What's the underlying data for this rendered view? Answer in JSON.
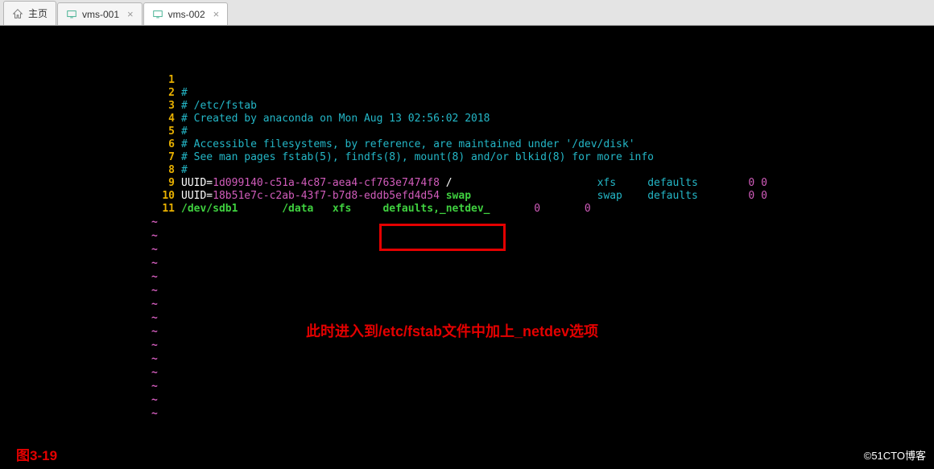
{
  "tabs": [
    {
      "label": "主页",
      "closable": false
    },
    {
      "label": "vms-001",
      "closable": true
    },
    {
      "label": "vms-002",
      "closable": true,
      "active": true
    }
  ],
  "editor": {
    "lines": [
      {
        "n": "1",
        "parts": []
      },
      {
        "n": "2",
        "parts": [
          {
            "cls": "comment",
            "t": "#"
          }
        ]
      },
      {
        "n": "3",
        "parts": [
          {
            "cls": "comment",
            "t": "# /etc/fstab"
          }
        ]
      },
      {
        "n": "4",
        "parts": [
          {
            "cls": "comment",
            "t": "# Created by anaconda on Mon Aug 13 02:56:02 2018"
          }
        ]
      },
      {
        "n": "5",
        "parts": [
          {
            "cls": "comment",
            "t": "#"
          }
        ]
      },
      {
        "n": "6",
        "parts": [
          {
            "cls": "comment",
            "t": "# Accessible filesystems, by reference, are maintained under '/dev/disk'"
          }
        ]
      },
      {
        "n": "7",
        "parts": [
          {
            "cls": "comment",
            "t": "# See man pages fstab(5), findfs(8), mount(8) and/or blkid(8) for more info"
          }
        ]
      },
      {
        "n": "8",
        "parts": [
          {
            "cls": "comment",
            "t": "#"
          }
        ]
      },
      {
        "n": "9",
        "parts": [
          {
            "cls": "plain",
            "t": "UUID="
          },
          {
            "cls": "pink",
            "t": "1d099140-c51a-4c87-aea4-cf763e7474f8"
          },
          {
            "cls": "plain",
            "t": " /                       "
          },
          {
            "cls": "cyan",
            "t": "xfs     defaults        "
          },
          {
            "cls": "pink",
            "t": "0 0"
          }
        ]
      },
      {
        "n": "10",
        "parts": [
          {
            "cls": "plain",
            "t": "UUID="
          },
          {
            "cls": "pink",
            "t": "18b51e7c-c2ab-43f7-b7d8-eddb5efd4d54"
          },
          {
            "cls": "green",
            "t": " swap                    "
          },
          {
            "cls": "cyan",
            "t": "swap    defaults        "
          },
          {
            "cls": "pink",
            "t": "0 0"
          }
        ]
      },
      {
        "n": "11",
        "parts": [
          {
            "cls": "green",
            "t": "/dev/sdb1       /data   xfs     defaults,_netdev_       "
          },
          {
            "cls": "pink",
            "t": "0       0"
          }
        ]
      }
    ],
    "tilde_count": 15
  },
  "annotation_text": "此时进入到/etc/fstab文件中加上_netdev选项",
  "figure_label": "图3-19",
  "watermark": "©51CTO博客"
}
